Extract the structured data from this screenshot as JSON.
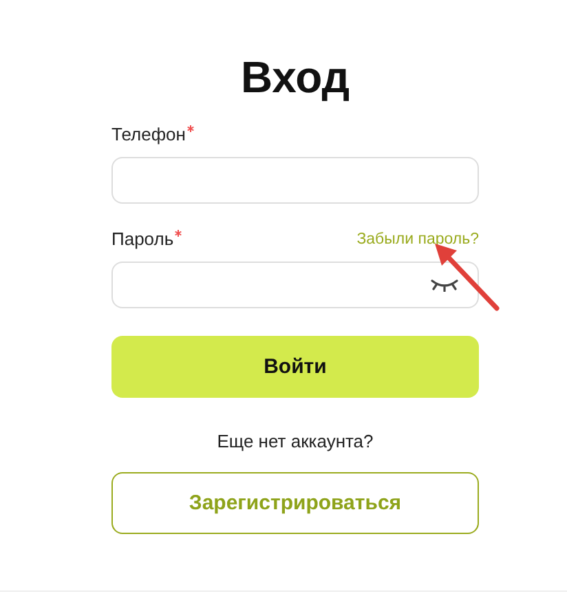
{
  "title": "Вход",
  "fields": [
    {
      "label": "Телефон",
      "required": true,
      "kind": "text"
    },
    {
      "label": "Пароль",
      "required": true,
      "kind": "password",
      "link": "Забыли пароль?"
    }
  ],
  "submit": {
    "label": "Войти",
    "kind": "primary"
  },
  "signup_prompt": "Еще нет аккаунта?",
  "signup": {
    "label": "Зарегистрироваться",
    "kind": "secondary"
  }
}
